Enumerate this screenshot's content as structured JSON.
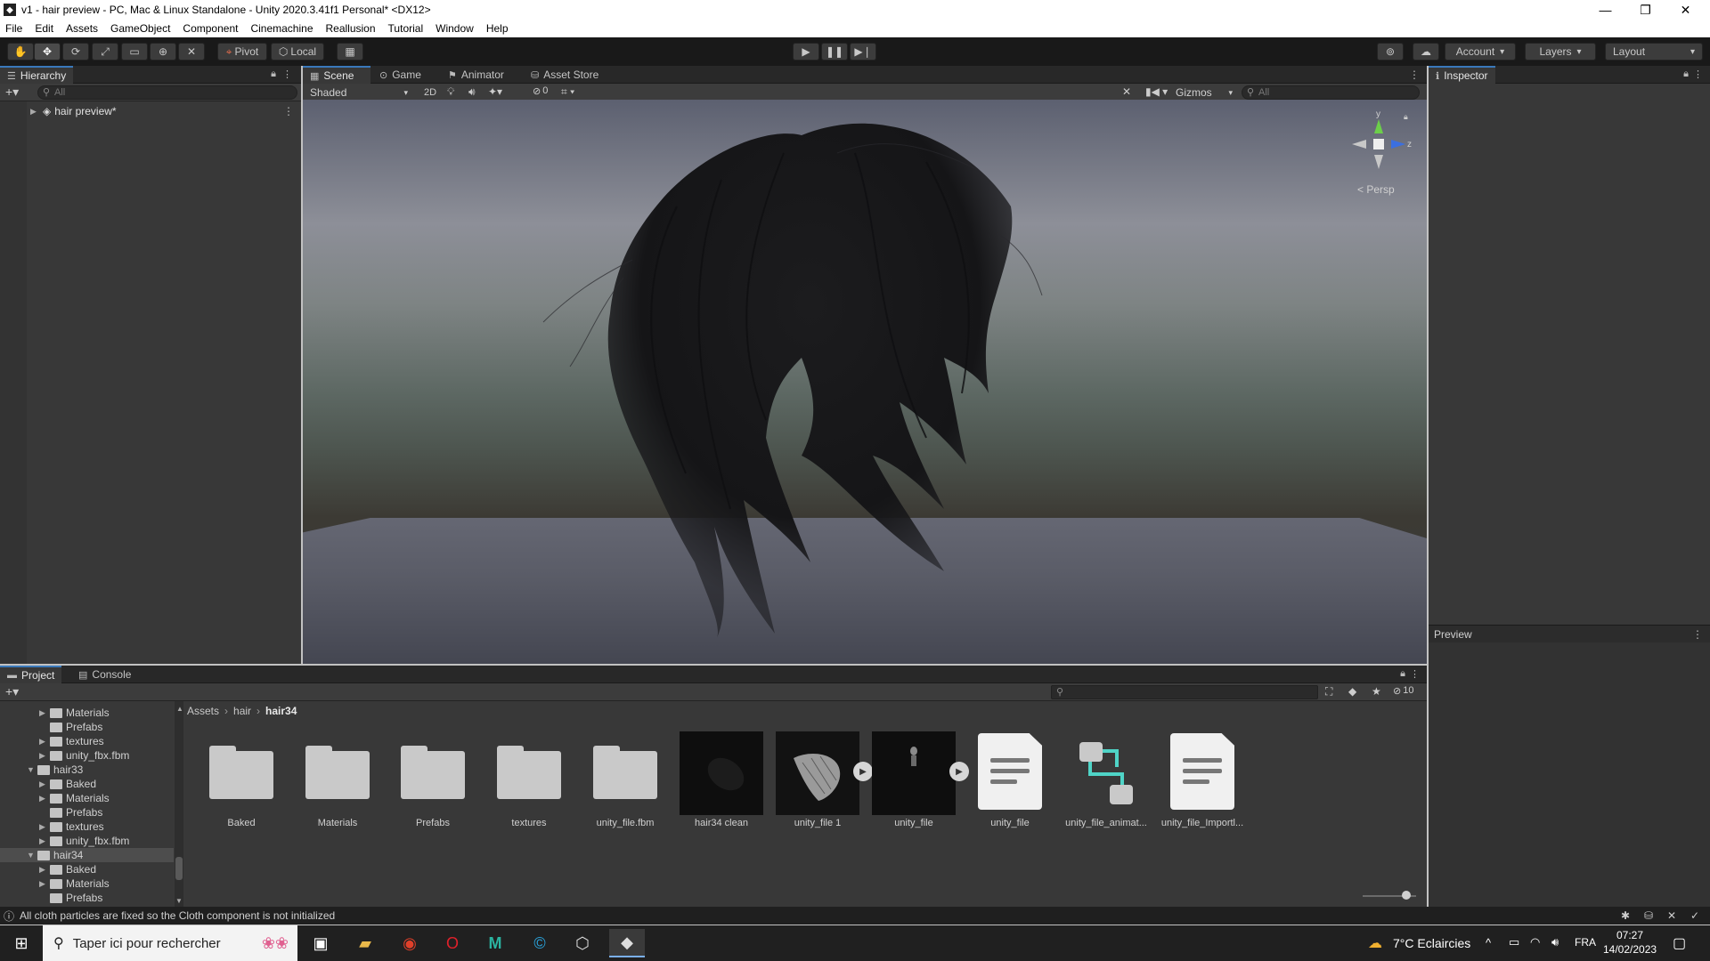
{
  "window": {
    "title": "v1 - hair preview - PC, Mac & Linux Standalone - Unity 2020.3.41f1 Personal* <DX12>",
    "minimize": "—",
    "restore": "❐",
    "close": "✕"
  },
  "menu": [
    "File",
    "Edit",
    "Assets",
    "GameObject",
    "Component",
    "Cinemachine",
    "Reallusion",
    "Tutorial",
    "Window",
    "Help"
  ],
  "toolbar": {
    "pivot": "Pivot",
    "local": "Local",
    "account": "Account",
    "layers": "Layers",
    "layout": "Layout"
  },
  "hierarchy": {
    "tab": "Hierarchy",
    "search_placeholder": "All",
    "root": "hair preview*"
  },
  "scene": {
    "tabs": [
      "Scene",
      "Game",
      "Animator",
      "Asset Store"
    ],
    "shading": "Shaded",
    "mode_2d": "2D",
    "hidden_count": "0",
    "gizmos": "Gizmos",
    "search_placeholder": "All",
    "axis_y": "y",
    "axis_z": "z",
    "persp": "< Persp"
  },
  "inspector": {
    "tab": "Inspector",
    "preview": "Preview"
  },
  "project": {
    "tabs": [
      "Project",
      "Console"
    ],
    "hidden_count": "10",
    "breadcrumb": [
      "Assets",
      "hair",
      "hair34"
    ],
    "tree": [
      {
        "label": "Materials",
        "indent": 2,
        "expandable": true
      },
      {
        "label": "Prefabs",
        "indent": 2,
        "expandable": false
      },
      {
        "label": "textures",
        "indent": 2,
        "expandable": true
      },
      {
        "label": "unity_fbx.fbm",
        "indent": 2,
        "expandable": true
      },
      {
        "label": "hair33",
        "indent": 1,
        "expandable": true,
        "open": true
      },
      {
        "label": "Baked",
        "indent": 2,
        "expandable": true
      },
      {
        "label": "Materials",
        "indent": 2,
        "expandable": true
      },
      {
        "label": "Prefabs",
        "indent": 2,
        "expandable": false
      },
      {
        "label": "textures",
        "indent": 2,
        "expandable": true
      },
      {
        "label": "unity_fbx.fbm",
        "indent": 2,
        "expandable": true
      },
      {
        "label": "hair34",
        "indent": 1,
        "expandable": true,
        "open": true,
        "selected": true
      },
      {
        "label": "Baked",
        "indent": 2,
        "expandable": true
      },
      {
        "label": "Materials",
        "indent": 2,
        "expandable": true
      },
      {
        "label": "Prefabs",
        "indent": 2,
        "expandable": false
      }
    ],
    "assets": [
      {
        "label": "Baked",
        "kind": "folder"
      },
      {
        "label": "Materials",
        "kind": "folder"
      },
      {
        "label": "Prefabs",
        "kind": "folder"
      },
      {
        "label": "textures",
        "kind": "folder"
      },
      {
        "label": "unity_file.fbm",
        "kind": "folder"
      },
      {
        "label": "hair34 clean",
        "kind": "dark"
      },
      {
        "label": "unity_file 1",
        "kind": "model"
      },
      {
        "label": "unity_file",
        "kind": "figure"
      },
      {
        "label": "unity_file",
        "kind": "doc"
      },
      {
        "label": "unity_file_animat...",
        "kind": "anim"
      },
      {
        "label": "unity_file_Importl...",
        "kind": "doc"
      }
    ]
  },
  "status": {
    "message": "All cloth particles are fixed so the Cloth component is not initialized"
  },
  "taskbar": {
    "search_placeholder": "Taper ici pour rechercher",
    "weather": "7°C  Eclaircies",
    "language": "FRA",
    "time": "07:27",
    "date": "14/02/2023"
  },
  "colors": {
    "accent": "#3a79bb",
    "panel": "#383838",
    "toolbar": "#191919"
  }
}
